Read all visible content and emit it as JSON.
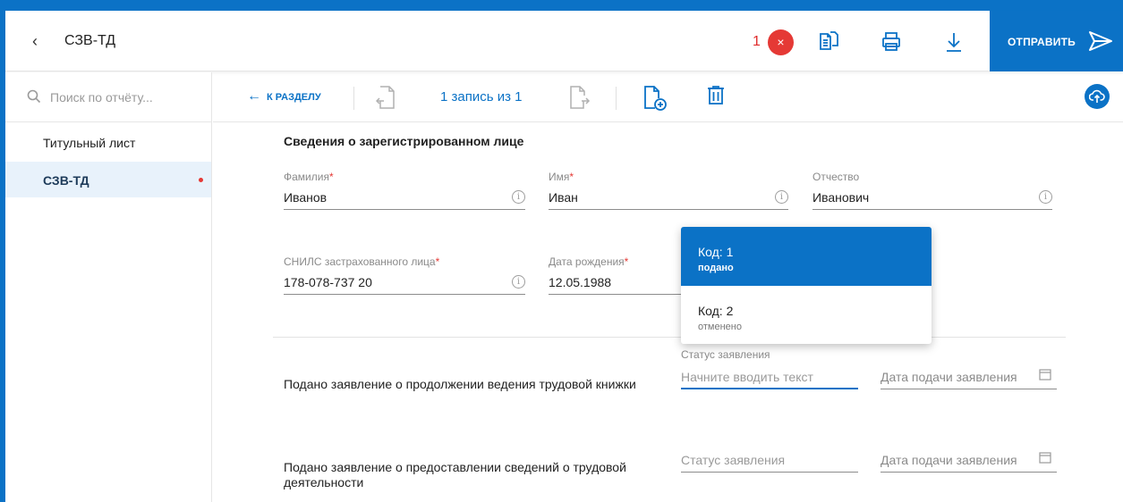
{
  "header": {
    "title": "СЗВ-ТД",
    "error_count": "1",
    "error_badge_glyph": "×",
    "send_label": "ОТПРАВИТЬ",
    "icons": [
      "chevron-left-icon",
      "close-icon",
      "copy-document-icon",
      "printer-icon",
      "download-icon",
      "send-icon"
    ],
    "accent_color": "#0b72c6",
    "error_color": "#e53935"
  },
  "sidebar": {
    "search_placeholder": "Поиск по отчёту...",
    "items": [
      {
        "label": "Титульный лист",
        "active": false
      },
      {
        "label": "СЗВ-ТД",
        "active": true,
        "has_error": true
      }
    ]
  },
  "toolbar": {
    "to_section_label": "К РАЗДЕЛУ",
    "record_label": "1 запись из 1",
    "icons": [
      "arrow-left-icon",
      "prev-record-icon",
      "next-record-icon",
      "add-record-icon",
      "trash-icon",
      "cloud-upload-icon"
    ]
  },
  "main": {
    "section_title": "Сведения о зарегистрированном лице",
    "fields": {
      "surname": {
        "label": "Фамилия",
        "required": "*",
        "value": "Иванов"
      },
      "name": {
        "label": "Имя",
        "required": "*",
        "value": "Иван"
      },
      "patronymic": {
        "label": "Отчество",
        "value": "Иванович"
      },
      "snils": {
        "label": "СНИЛС застрахованного лица",
        "required": "*",
        "value": "178-078-737 20"
      },
      "birth_date": {
        "label": "Дата рождения",
        "required": "*",
        "value": "12.05.1988"
      }
    },
    "info_glyph": "i",
    "rows": [
      {
        "text": "Подано заявление о продолжении ведения трудовой книжки",
        "status_label": "Статус заявления",
        "status_placeholder": "Начните вводить текст",
        "date_placeholder": "Дата подачи заявления"
      },
      {
        "text_line1": "Подано заявление о предоставлении сведений о трудовой",
        "text_line2": "деятельности",
        "status_placeholder": "Статус заявления",
        "date_placeholder": "Дата подачи заявления"
      }
    ]
  },
  "dropdown": {
    "options": [
      {
        "code": "Код: 1",
        "desc": "подано",
        "selected": true
      },
      {
        "code": "Код: 2",
        "desc": "отменено",
        "selected": false
      }
    ]
  }
}
